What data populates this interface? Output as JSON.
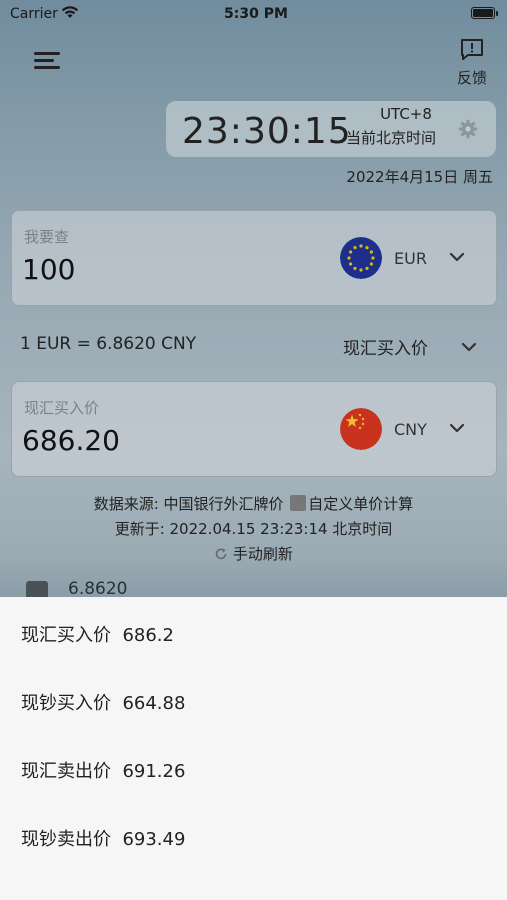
{
  "status_bar": {
    "carrier": "Carrier",
    "time": "5:30 PM"
  },
  "header": {
    "feedback_label": "反馈"
  },
  "clock": {
    "time": "23:30:15",
    "tz_offset": "UTC+8",
    "tz_name": "当前北京时间",
    "date": "2022年4月15日 周五"
  },
  "from": {
    "label": "我要查",
    "value": "100",
    "currency": "EUR"
  },
  "rate": {
    "text": "1 EUR = 6.8620 CNY",
    "type": "现汇买入价"
  },
  "to": {
    "label": "现汇买入价",
    "value": "686.20",
    "currency": "CNY"
  },
  "info": {
    "source_prefix": "数据来源: 中国银行外汇牌价",
    "custom_calc": "自定义单价计算",
    "updated": "更新于: 2022.04.15 23:23:14 北京时间",
    "refresh": "手动刷新"
  },
  "peek": {
    "value": "6.8620"
  },
  "sheet": {
    "options": [
      {
        "label": "现汇买入价",
        "value": "686.2"
      },
      {
        "label": "现钞买入价",
        "value": "664.88"
      },
      {
        "label": "现汇卖出价",
        "value": "691.26"
      },
      {
        "label": "现钞卖出价",
        "value": "693.49"
      }
    ]
  },
  "colors": {
    "eu_blue": "#003399",
    "eu_star": "#ffcc00",
    "cn_red": "#de2910",
    "cn_star": "#ffde00"
  },
  "icons": [
    "menu-icon",
    "feedback-icon",
    "gear-icon",
    "chevron-down-icon",
    "calculator-icon",
    "refresh-icon",
    "wifi-icon",
    "battery-icon"
  ]
}
